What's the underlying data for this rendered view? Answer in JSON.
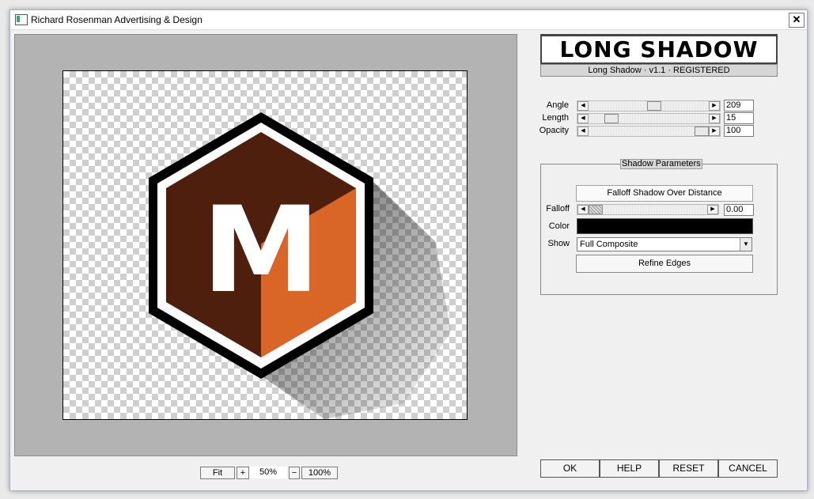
{
  "window": {
    "title": "Richard Rosenman Advertising & Design",
    "close_glyph": "✕"
  },
  "plugin": {
    "logo_text": "LONG SHADOW",
    "version": "Long Shadow · v1.1 · REGISTERED"
  },
  "sliders": [
    {
      "label": "Angle",
      "value": "209",
      "level": 0.55
    },
    {
      "label": "Length",
      "value": "15",
      "level": 0.15
    },
    {
      "label": "Opacity",
      "value": "100",
      "level": 1.0
    }
  ],
  "shadow_params": {
    "title": "Shadow Parameters",
    "falloff_button": "Falloff Shadow Over Distance",
    "falloff_label": "Falloff",
    "falloff_value": "0.00",
    "color_label": "Color",
    "color_value": "#000000",
    "show_label": "Show",
    "show_value": "Full Composite",
    "refine_button": "Refine Edges"
  },
  "zoom": {
    "fit": "Fit",
    "plus": "+",
    "value": "50%",
    "minus": "−",
    "full": "100%"
  },
  "buttons": {
    "ok": "OK",
    "help": "HELP",
    "reset": "RESET",
    "cancel": "CANCEL"
  },
  "preview": {
    "logo_letter": "M",
    "colors": {
      "dark_brown": "#4f1f0e",
      "orange": "#d96527",
      "outline": "#000000",
      "border": "#ffffff"
    }
  },
  "icons": {
    "left_arrow": "◀",
    "right_arrow": "▶",
    "dropdown": "▼"
  }
}
